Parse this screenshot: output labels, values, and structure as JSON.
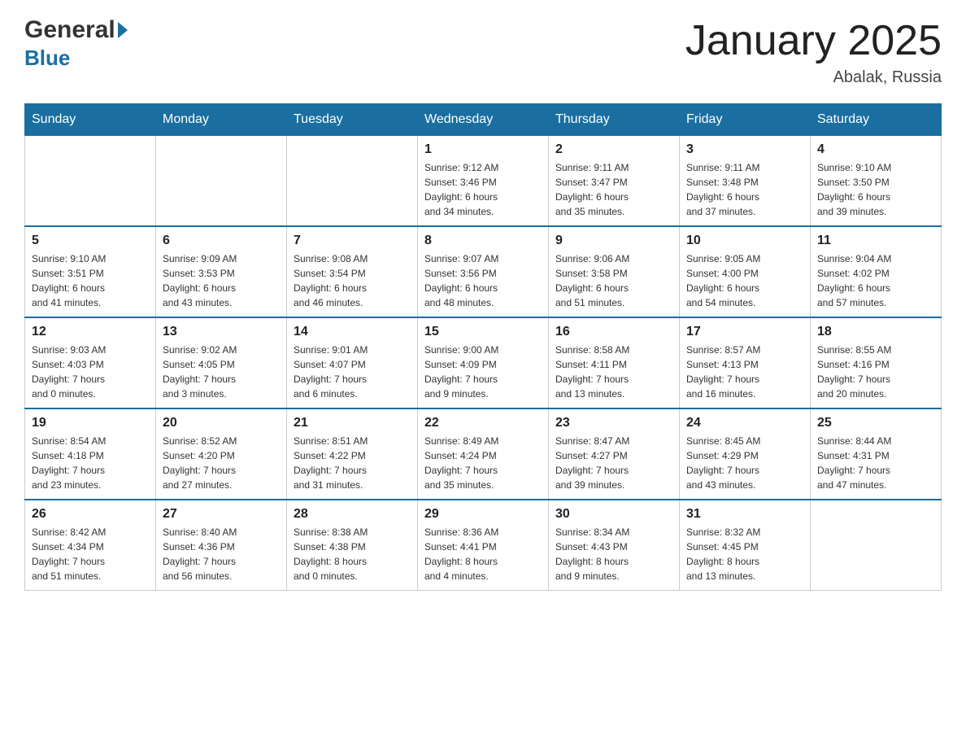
{
  "header": {
    "logo_general": "General",
    "logo_blue": "Blue",
    "month_title": "January 2025",
    "location": "Abalak, Russia"
  },
  "days_of_week": [
    "Sunday",
    "Monday",
    "Tuesday",
    "Wednesday",
    "Thursday",
    "Friday",
    "Saturday"
  ],
  "weeks": [
    [
      {
        "day": "",
        "info": ""
      },
      {
        "day": "",
        "info": ""
      },
      {
        "day": "",
        "info": ""
      },
      {
        "day": "1",
        "info": "Sunrise: 9:12 AM\nSunset: 3:46 PM\nDaylight: 6 hours\nand 34 minutes."
      },
      {
        "day": "2",
        "info": "Sunrise: 9:11 AM\nSunset: 3:47 PM\nDaylight: 6 hours\nand 35 minutes."
      },
      {
        "day": "3",
        "info": "Sunrise: 9:11 AM\nSunset: 3:48 PM\nDaylight: 6 hours\nand 37 minutes."
      },
      {
        "day": "4",
        "info": "Sunrise: 9:10 AM\nSunset: 3:50 PM\nDaylight: 6 hours\nand 39 minutes."
      }
    ],
    [
      {
        "day": "5",
        "info": "Sunrise: 9:10 AM\nSunset: 3:51 PM\nDaylight: 6 hours\nand 41 minutes."
      },
      {
        "day": "6",
        "info": "Sunrise: 9:09 AM\nSunset: 3:53 PM\nDaylight: 6 hours\nand 43 minutes."
      },
      {
        "day": "7",
        "info": "Sunrise: 9:08 AM\nSunset: 3:54 PM\nDaylight: 6 hours\nand 46 minutes."
      },
      {
        "day": "8",
        "info": "Sunrise: 9:07 AM\nSunset: 3:56 PM\nDaylight: 6 hours\nand 48 minutes."
      },
      {
        "day": "9",
        "info": "Sunrise: 9:06 AM\nSunset: 3:58 PM\nDaylight: 6 hours\nand 51 minutes."
      },
      {
        "day": "10",
        "info": "Sunrise: 9:05 AM\nSunset: 4:00 PM\nDaylight: 6 hours\nand 54 minutes."
      },
      {
        "day": "11",
        "info": "Sunrise: 9:04 AM\nSunset: 4:02 PM\nDaylight: 6 hours\nand 57 minutes."
      }
    ],
    [
      {
        "day": "12",
        "info": "Sunrise: 9:03 AM\nSunset: 4:03 PM\nDaylight: 7 hours\nand 0 minutes."
      },
      {
        "day": "13",
        "info": "Sunrise: 9:02 AM\nSunset: 4:05 PM\nDaylight: 7 hours\nand 3 minutes."
      },
      {
        "day": "14",
        "info": "Sunrise: 9:01 AM\nSunset: 4:07 PM\nDaylight: 7 hours\nand 6 minutes."
      },
      {
        "day": "15",
        "info": "Sunrise: 9:00 AM\nSunset: 4:09 PM\nDaylight: 7 hours\nand 9 minutes."
      },
      {
        "day": "16",
        "info": "Sunrise: 8:58 AM\nSunset: 4:11 PM\nDaylight: 7 hours\nand 13 minutes."
      },
      {
        "day": "17",
        "info": "Sunrise: 8:57 AM\nSunset: 4:13 PM\nDaylight: 7 hours\nand 16 minutes."
      },
      {
        "day": "18",
        "info": "Sunrise: 8:55 AM\nSunset: 4:16 PM\nDaylight: 7 hours\nand 20 minutes."
      }
    ],
    [
      {
        "day": "19",
        "info": "Sunrise: 8:54 AM\nSunset: 4:18 PM\nDaylight: 7 hours\nand 23 minutes."
      },
      {
        "day": "20",
        "info": "Sunrise: 8:52 AM\nSunset: 4:20 PM\nDaylight: 7 hours\nand 27 minutes."
      },
      {
        "day": "21",
        "info": "Sunrise: 8:51 AM\nSunset: 4:22 PM\nDaylight: 7 hours\nand 31 minutes."
      },
      {
        "day": "22",
        "info": "Sunrise: 8:49 AM\nSunset: 4:24 PM\nDaylight: 7 hours\nand 35 minutes."
      },
      {
        "day": "23",
        "info": "Sunrise: 8:47 AM\nSunset: 4:27 PM\nDaylight: 7 hours\nand 39 minutes."
      },
      {
        "day": "24",
        "info": "Sunrise: 8:45 AM\nSunset: 4:29 PM\nDaylight: 7 hours\nand 43 minutes."
      },
      {
        "day": "25",
        "info": "Sunrise: 8:44 AM\nSunset: 4:31 PM\nDaylight: 7 hours\nand 47 minutes."
      }
    ],
    [
      {
        "day": "26",
        "info": "Sunrise: 8:42 AM\nSunset: 4:34 PM\nDaylight: 7 hours\nand 51 minutes."
      },
      {
        "day": "27",
        "info": "Sunrise: 8:40 AM\nSunset: 4:36 PM\nDaylight: 7 hours\nand 56 minutes."
      },
      {
        "day": "28",
        "info": "Sunrise: 8:38 AM\nSunset: 4:38 PM\nDaylight: 8 hours\nand 0 minutes."
      },
      {
        "day": "29",
        "info": "Sunrise: 8:36 AM\nSunset: 4:41 PM\nDaylight: 8 hours\nand 4 minutes."
      },
      {
        "day": "30",
        "info": "Sunrise: 8:34 AM\nSunset: 4:43 PM\nDaylight: 8 hours\nand 9 minutes."
      },
      {
        "day": "31",
        "info": "Sunrise: 8:32 AM\nSunset: 4:45 PM\nDaylight: 8 hours\nand 13 minutes."
      },
      {
        "day": "",
        "info": ""
      }
    ]
  ]
}
